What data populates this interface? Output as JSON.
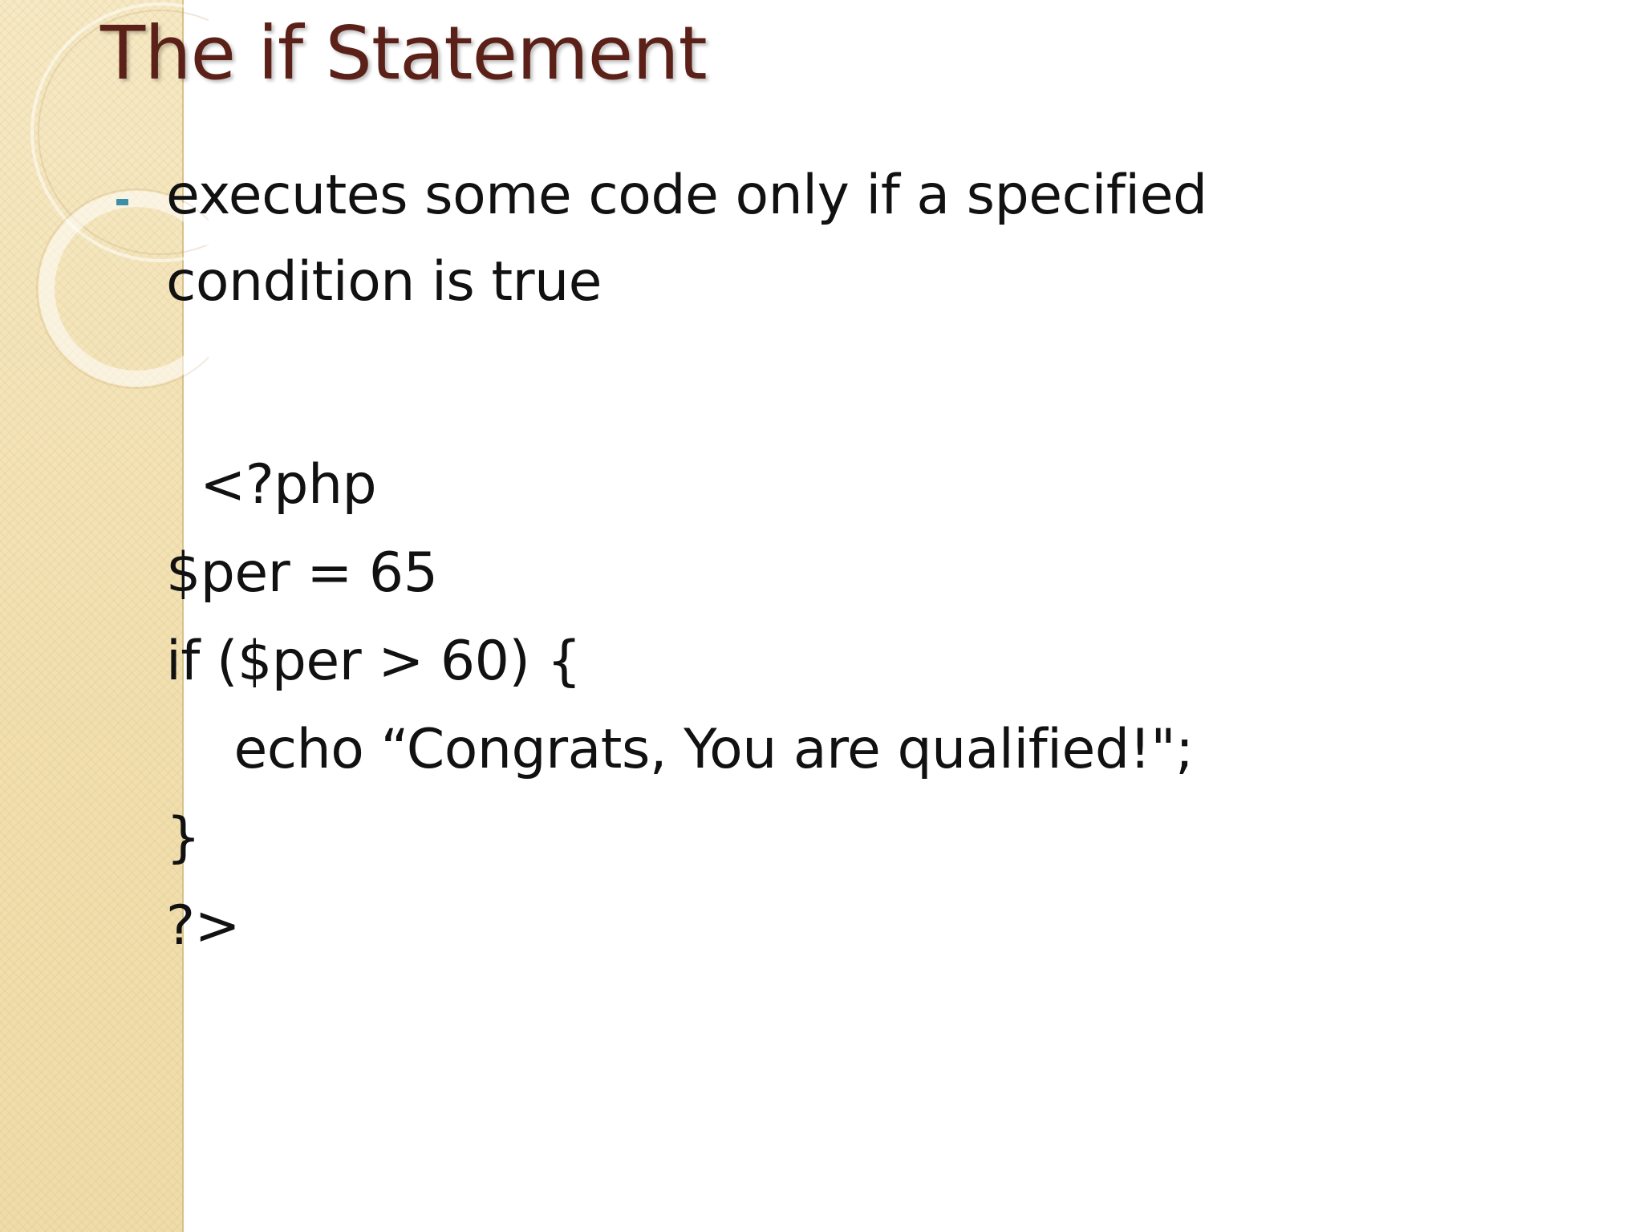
{
  "slide": {
    "title": "The if Statement",
    "bullet": "executes some code only if a specified condition is true",
    "code_lines": [
      "  <?php",
      "$per = 65",
      "if ($per > 60) {",
      "    echo “Congrats, You are qualified!\";",
      "}",
      "?>"
    ]
  },
  "colors": {
    "title": "#5b2119",
    "bullet_marker": "#3c8fa7",
    "side_panel": "#f3e3b6",
    "text": "#111111"
  }
}
